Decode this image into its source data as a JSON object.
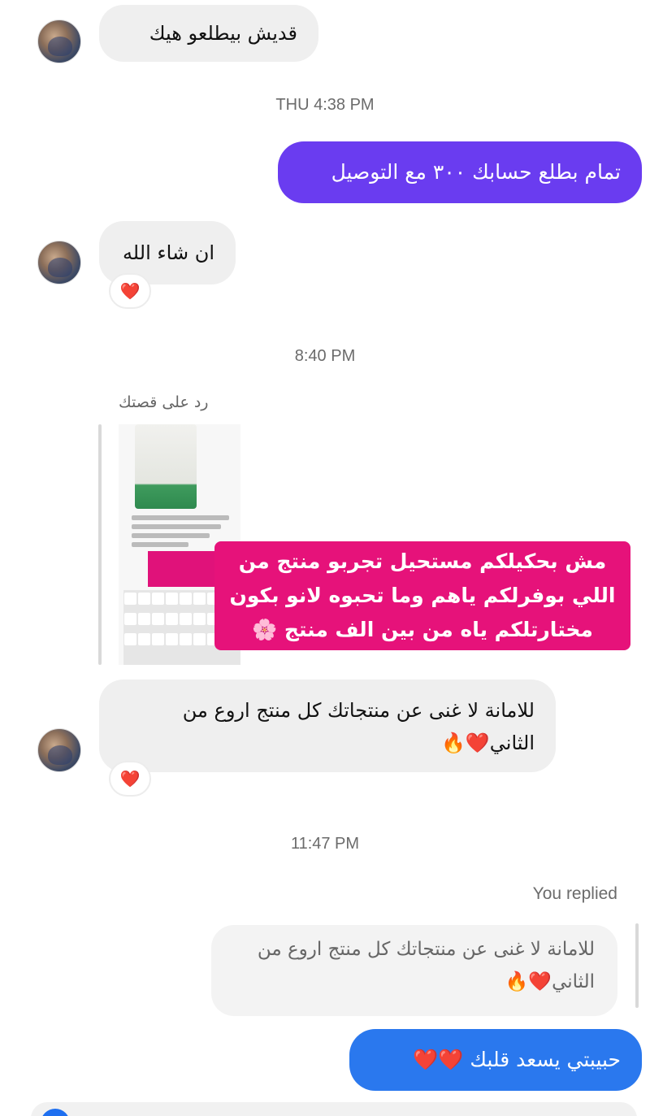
{
  "messages": {
    "m1": "قديش بيطلعو هيك",
    "t1": "THU 4:38 PM",
    "m2": "تمام بطلع حسابك ٣٠٠ مع التوصيل",
    "m3": "ان شاء الله",
    "r3": "❤️",
    "t2": "8:40 PM",
    "story_label": "رد على قصتك",
    "story_overlay_l1": "مش بحكيلكم مستحيل تجربو منتج من",
    "story_overlay_l2": "اللي بوفرلكم ياهم وما تحبوه لانو بكون",
    "story_overlay_l3": "مختارتلكم ياه من بين الف منتج 🌸",
    "m4_l1": "للامانة لا غنى عن منتجاتك كل منتج اروع من",
    "m4_l2": "الثاني❤️🔥",
    "r4": "❤️",
    "t3": "11:47 PM",
    "you_replied": "You replied",
    "quoted_l1": "للامانة لا غنى عن منتجاتك كل منتج اروع من",
    "quoted_l2": "الثاني❤️🔥",
    "m5": "حبيبتي يسعد قلبك ❤️❤️"
  },
  "colors": {
    "outgoing_purple": "#6a3cf0",
    "outgoing_blue": "#2a78ee",
    "incoming_gray": "#efefef",
    "story_pink": "#e6127a"
  },
  "icons": [
    "avatar",
    "heart-reaction",
    "story-thumbnail"
  ]
}
